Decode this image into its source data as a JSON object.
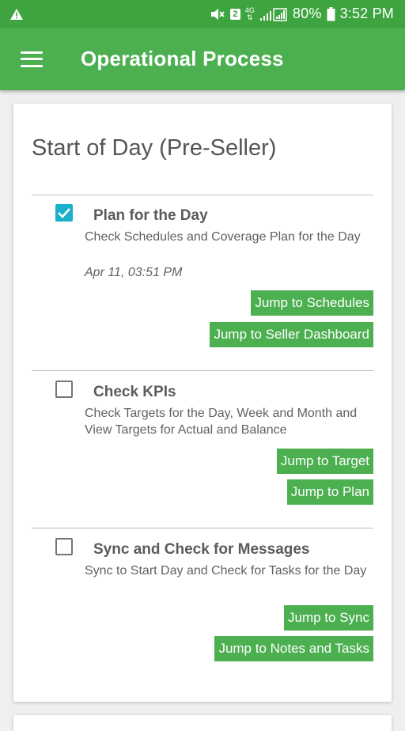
{
  "status_bar": {
    "time": "3:52 PM",
    "battery": "80%",
    "sim": "2",
    "network": "4G",
    "icons": [
      "warning-icon",
      "mute-icon",
      "sim-icon",
      "signal-icon",
      "battery-icon"
    ]
  },
  "app_bar": {
    "title": "Operational Process",
    "menu_icon": "hamburger-menu-icon"
  },
  "card": {
    "section_title": "Start of Day (Pre-Seller)",
    "tasks": [
      {
        "title": "Plan for the Day",
        "description": "Check Schedules and Coverage Plan for the Day",
        "timestamp": "Apr 11, 03:51 PM",
        "checked": true,
        "buttons": [
          "Jump to Schedules",
          "Jump to Seller Dashboard"
        ]
      },
      {
        "title": "Check KPIs",
        "description": "Check Targets for the Day, Week and Month and View Targets for Actual and Balance",
        "timestamp": "",
        "checked": false,
        "buttons": [
          "Jump to Target",
          "Jump to Plan"
        ]
      },
      {
        "title": "Sync and Check for Messages",
        "description": "Sync to Start Day and Check for Tasks for the Day",
        "timestamp": "",
        "checked": false,
        "buttons": [
          "Jump to Sync",
          "Jump to Notes and Tasks"
        ]
      }
    ]
  },
  "colors": {
    "status_bar": "#3ea43f",
    "app_bar": "#4caf50",
    "button": "#4caf50",
    "checkbox_checked": "#1ab0c9"
  }
}
